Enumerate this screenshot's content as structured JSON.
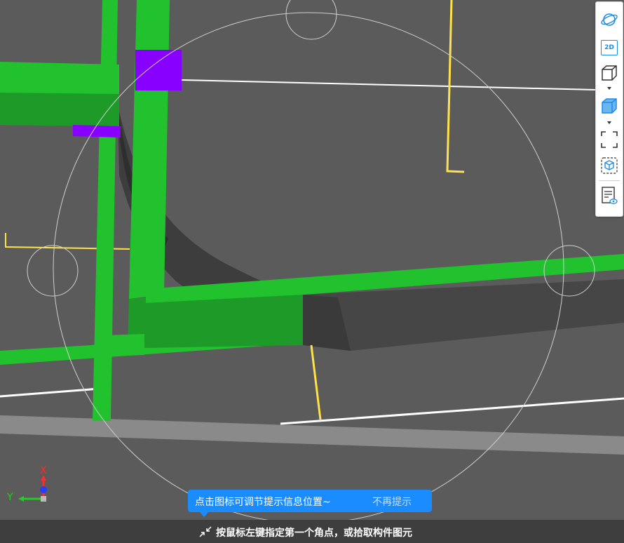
{
  "viewcube_toolbar": {
    "items": [
      {
        "name": "orbit",
        "icon": "orbit-icon"
      },
      {
        "name": "view-2d",
        "icon": "2d-view-icon",
        "label": "2D"
      },
      {
        "name": "display-mode-wireframe",
        "icon": "cube-outline-icon",
        "has_dropdown": true
      },
      {
        "name": "display-mode-solid",
        "icon": "cube-filled-icon",
        "has_dropdown": true
      },
      {
        "name": "fit-view",
        "icon": "fullscreen-corners-icon"
      },
      {
        "name": "section-box",
        "icon": "cube-select-icon"
      },
      {
        "name": "properties",
        "icon": "document-view-icon"
      }
    ]
  },
  "tip": {
    "message": "点击图标可调节提示信息位置~",
    "dismiss": "不再提示"
  },
  "status_bar": {
    "prompt": "按鼠标左键指定第一个角点，或拾取构件图元"
  },
  "axis_gizmo": {
    "x_label": "X",
    "y_label": "Y",
    "colors": {
      "x": "#ff2a2a",
      "y": "#22cc22",
      "z": "#2a3cff"
    }
  },
  "colors": {
    "background": "#5b5b5b",
    "beam_green": "#22c22e",
    "beam_green_dark": "#1e9a28",
    "duct_dark": "#3d3d3d",
    "purple": "#8800ff",
    "yellow_line": "#ffe24a",
    "status_bar": "#3e3e3e",
    "tooltip": "#1a8cff"
  }
}
